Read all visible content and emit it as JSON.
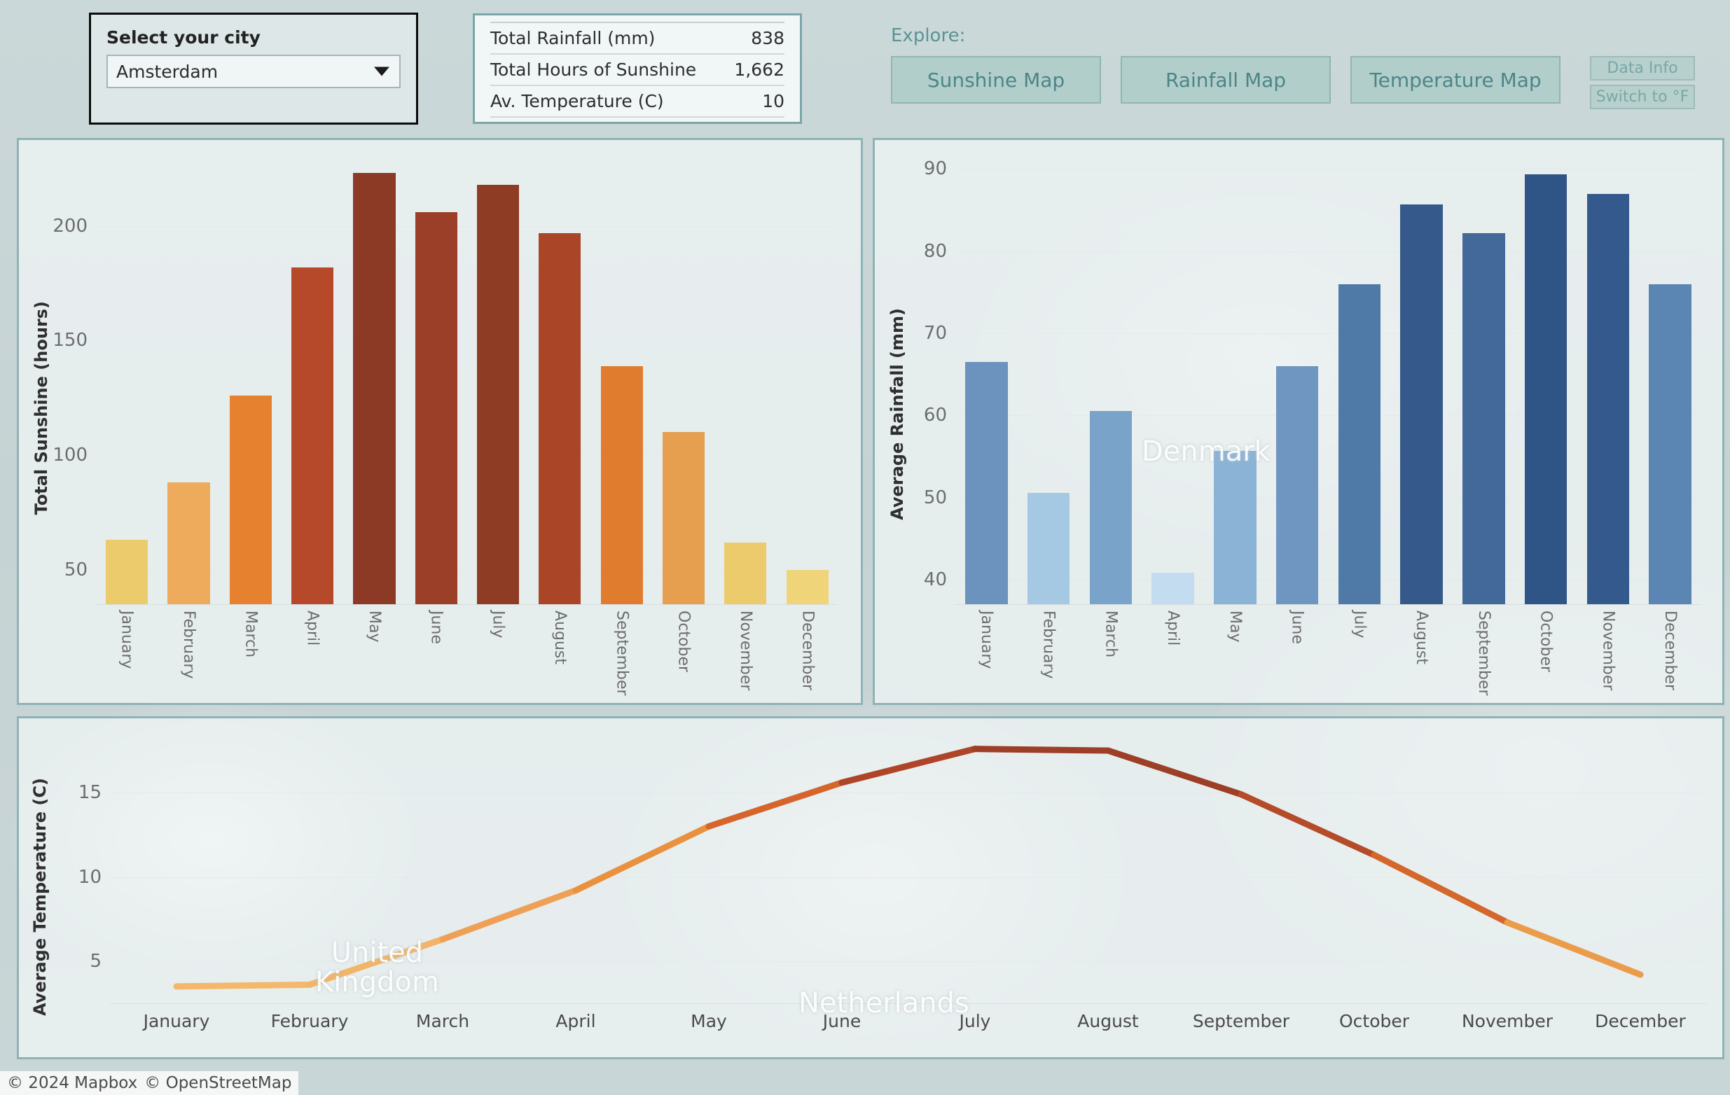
{
  "city_selector": {
    "label": "Select your city",
    "value": "Amsterdam",
    "caret_icon": "chevron-down-icon"
  },
  "stats": {
    "rows": [
      {
        "label": "Total Rainfall (mm)",
        "value": "838"
      },
      {
        "label": "Total Hours of Sunshine",
        "value": "1,662"
      },
      {
        "label": "Av. Temperature (C)",
        "value": "10"
      }
    ]
  },
  "explore": {
    "label": "Explore:",
    "buttons": [
      {
        "label": "Sunshine Map"
      },
      {
        "label": "Rainfall Map"
      },
      {
        "label": "Temperature Map"
      }
    ],
    "mini_buttons": [
      {
        "label": "Data Info"
      },
      {
        "label": "Switch to °F"
      }
    ]
  },
  "map_labels": {
    "denmark": "Denmark",
    "united_kingdom_line1": "United",
    "united_kingdom_line2": "Kingdom",
    "netherlands": "Netherlands"
  },
  "attribution": {
    "mapbox": "© 2024 Mapbox",
    "osm": "© OpenStreetMap"
  },
  "colors": {
    "page_bg": "#c4d2d3",
    "panel_bg": "#f2f6f7",
    "panel_border": "#8fb3b5",
    "accent_teal": "#5a9396",
    "map_button": "#b2ceca"
  },
  "chart_data": [
    {
      "id": "sunshine",
      "type": "bar",
      "title": "",
      "ylabel": "Total Sunshine (hours)",
      "xlabel": "",
      "ylim": [
        35,
        232
      ],
      "yticks": [
        50,
        100,
        150,
        200
      ],
      "grid": true,
      "categories": [
        "January",
        "February",
        "March",
        "April",
        "May",
        "June",
        "July",
        "August",
        "September",
        "October",
        "November",
        "December"
      ],
      "values": [
        63,
        88,
        126,
        182,
        223,
        206,
        218,
        197,
        139,
        110,
        62,
        50
      ],
      "bar_colors": [
        "#eccb6d",
        "#eeab5c",
        "#e5812f",
        "#b5492a",
        "#8c3a25",
        "#9c3f28",
        "#8f3c25",
        "#ab4528",
        "#e07c2e",
        "#e59f4f",
        "#eccb6d",
        "#efd47a"
      ]
    },
    {
      "id": "rainfall",
      "type": "bar",
      "title": "",
      "ylabel": "Average Rainfall (mm)",
      "xlabel": "",
      "ylim": [
        37,
        92
      ],
      "yticks": [
        40,
        50,
        60,
        70,
        80,
        90
      ],
      "grid": true,
      "categories": [
        "January",
        "February",
        "March",
        "April",
        "May",
        "June",
        "July",
        "August",
        "September",
        "October",
        "November",
        "December"
      ],
      "values": [
        66.5,
        50.6,
        60.5,
        40.8,
        55.7,
        66,
        76,
        85.7,
        82.2,
        89.4,
        87,
        76
      ],
      "bar_colors": [
        "#6b93bd",
        "#a5c8e3",
        "#7aa3ca",
        "#c3dcef",
        "#8bb3d6",
        "#6f96c0",
        "#4f7aa8",
        "#35598a",
        "#43699a",
        "#2f5486",
        "#34598c",
        "#5b85b2"
      ]
    },
    {
      "id": "temperature",
      "type": "line",
      "title": "",
      "ylabel": "Average Temperature (C)",
      "xlabel": "",
      "ylim": [
        2.5,
        18.5
      ],
      "yticks": [
        5,
        10,
        15
      ],
      "grid": true,
      "categories": [
        "January",
        "February",
        "March",
        "April",
        "May",
        "June",
        "July",
        "August",
        "September",
        "October",
        "November",
        "December"
      ],
      "values": [
        3.5,
        3.6,
        6.3,
        9.2,
        13.0,
        15.6,
        17.6,
        17.5,
        14.9,
        11.3,
        7.3,
        4.2
      ],
      "line_colors": [
        "#f3b86b",
        "#f2b468",
        "#eea156",
        "#e9913f",
        "#d6652c",
        "#ae4528",
        "#9d3e26",
        "#9d3e26",
        "#b54c29",
        "#d4672c",
        "#ea9c4a",
        "#f5bd70"
      ]
    }
  ]
}
